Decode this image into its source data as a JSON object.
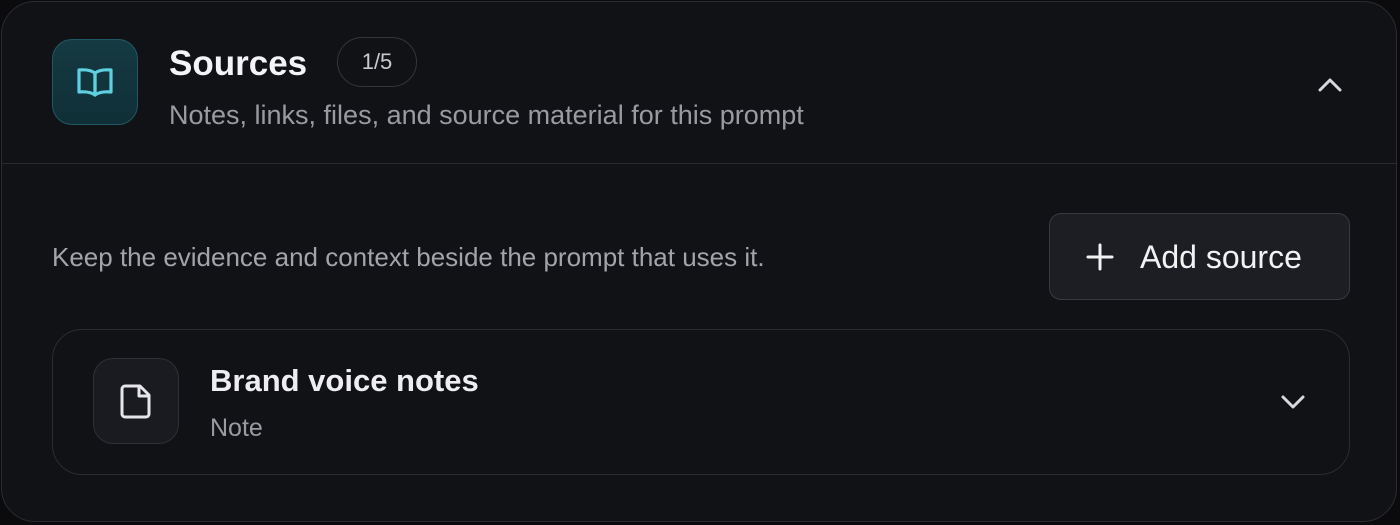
{
  "header": {
    "title": "Sources",
    "count_badge": "1/5",
    "subtitle": "Notes, links, files, and source material for this prompt",
    "icon": "book-icon",
    "collapse_icon": "chevron-up-icon"
  },
  "body": {
    "intro_text": "Keep the evidence and context beside the prompt that uses it.",
    "add_button": {
      "label": "Add source",
      "icon": "plus-icon"
    }
  },
  "sources": [
    {
      "name": "Brand voice notes",
      "type": "Note",
      "icon": "document-icon",
      "expand_icon": "chevron-down-icon"
    }
  ],
  "colors": {
    "accent": "#5fd0e0",
    "accent_tile": "#123640",
    "panel_bg": "#111216",
    "text_primary": "#f4f4f6",
    "text_secondary": "#9a9ba2"
  }
}
